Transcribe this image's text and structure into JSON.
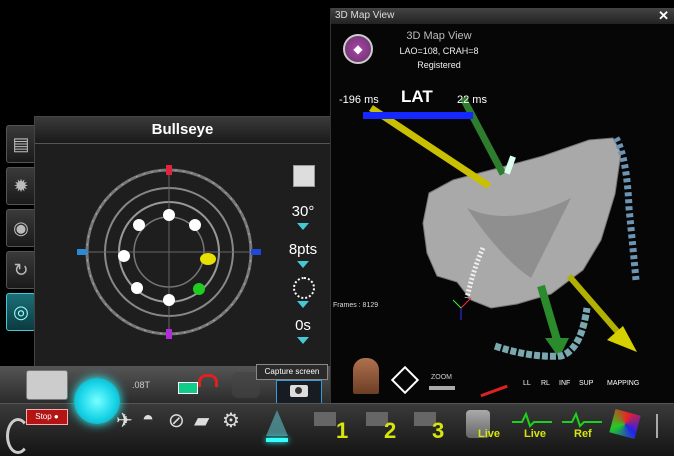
{
  "bullseye": {
    "title": "Bullseye",
    "angle": "30°",
    "points": "8pts",
    "time": "0s"
  },
  "map_view": {
    "window_title": "3D Map View",
    "header_title": "3D Map View",
    "orientation": "LAO=108, CRAH=8",
    "status": "Registered",
    "lat_min": "-196 ms",
    "lat_label": "LAT",
    "lat_max": "22 ms",
    "frames": "Frames : 8129",
    "zoom_label": "ZOOM",
    "view_buttons": [
      "LL",
      "RL",
      "INF",
      "SUP",
      "MAPPING"
    ]
  },
  "control_strip": {
    "capture_tooltip": "Capture screen",
    "tool_label": ".08T"
  },
  "bottom_bar": {
    "stop_label": "Stop",
    "frame_buttons": [
      "1",
      "2",
      "3"
    ],
    "live_labels": [
      "Live",
      "Live"
    ],
    "ref_label": "Ref"
  },
  "colors": {
    "accent": "#46c7d4",
    "lat_bar": "#1428ff",
    "frame_label": "#d6e60a",
    "stop": "#b31515"
  }
}
